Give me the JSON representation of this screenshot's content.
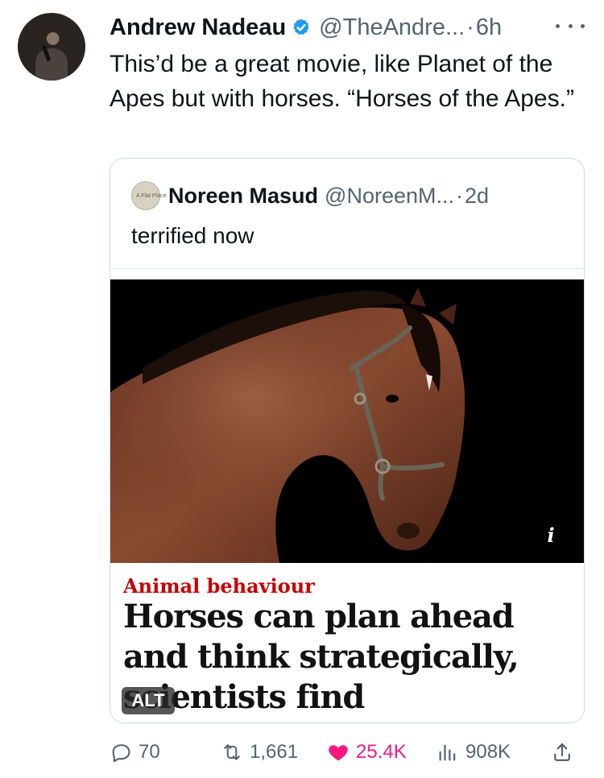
{
  "tweet": {
    "author_name": "Andrew Nadeau",
    "handle": "@TheAndre...",
    "separator": "·",
    "time": "6h",
    "text": "This’d be a great movie, like Planet of the Apes but with horses. “Horses of the Apes.”"
  },
  "quoted": {
    "avatar_label": "A Flat Place",
    "author_name": "Noreen Masud",
    "handle": "@NoreenM...",
    "separator": "·",
    "time": "2d",
    "text": "terrified now",
    "image_info_label": "i",
    "article_kicker": "Animal behaviour",
    "article_headline": "Horses can plan ahead and think strategically, scientists find",
    "alt_label": "ALT"
  },
  "actions": {
    "replies": "70",
    "reposts": "1,661",
    "likes": "25.4K",
    "views": "908K"
  },
  "colors": {
    "verified": "#1d9bf0",
    "like": "#f91880",
    "kicker": "#c70000",
    "muted": "#536471"
  },
  "icons": [
    "verified-badge-icon",
    "more-icon",
    "reply-icon",
    "repost-icon",
    "like-heart-icon",
    "views-icon",
    "share-icon",
    "info-icon"
  ]
}
